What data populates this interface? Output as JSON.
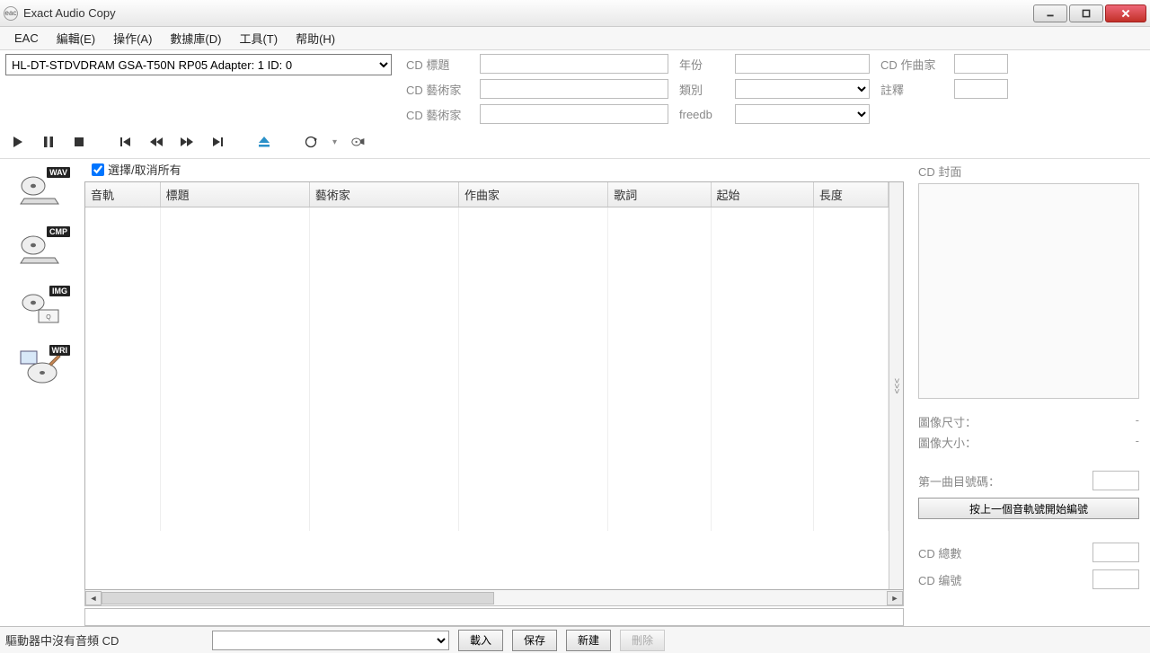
{
  "title": "Exact Audio Copy",
  "menubar": [
    "EAC",
    "編輯(E)",
    "操作(A)",
    "數據庫(D)",
    "工具(T)",
    "帮助(H)"
  ],
  "drive": "HL-DT-STDVDRAM GSA-T50N RP05   Adapter: 1  ID: 0",
  "meta": {
    "cd_title_label": "CD 標題",
    "cd_artist_label": "CD 藝術家",
    "cd_artist2_label": "CD 藝術家",
    "year_label": "年份",
    "genre_label": "類別",
    "freedb_label": "freedb",
    "composer_label": "CD 作曲家",
    "comment_label": "註釋",
    "cd_title": "",
    "cd_artist": "",
    "cd_artist2": "",
    "year": "",
    "genre": "",
    "freedb": "",
    "composer": "",
    "comment": ""
  },
  "select_all_label": "選擇/取消所有",
  "columns": {
    "track": "音軌",
    "title": "標題",
    "artist": "藝術家",
    "composer": "作曲家",
    "lyrics": "歌詞",
    "start": "起始",
    "length": "長度"
  },
  "left_tools": {
    "wav": "WAV",
    "cmp": "CMP",
    "img": "IMG",
    "wri": "WRI"
  },
  "right": {
    "cover_label": "CD 封面",
    "img_dim_label": "圖像尺寸：",
    "img_dim": "-",
    "img_size_label": "圖像大小：",
    "img_size": "-",
    "first_track_label": "第一曲目號碼：",
    "first_track": "",
    "renumber_btn": "按上一個音軌號開始編號",
    "cd_total_label": "CD 總數",
    "cd_total": "",
    "cd_number_label": "CD 编號",
    "cd_number": ""
  },
  "status": {
    "text": "驅動器中沒有音頻 CD",
    "load": "載入",
    "save": "保存",
    "new": "新建",
    "delete": "刪除"
  }
}
